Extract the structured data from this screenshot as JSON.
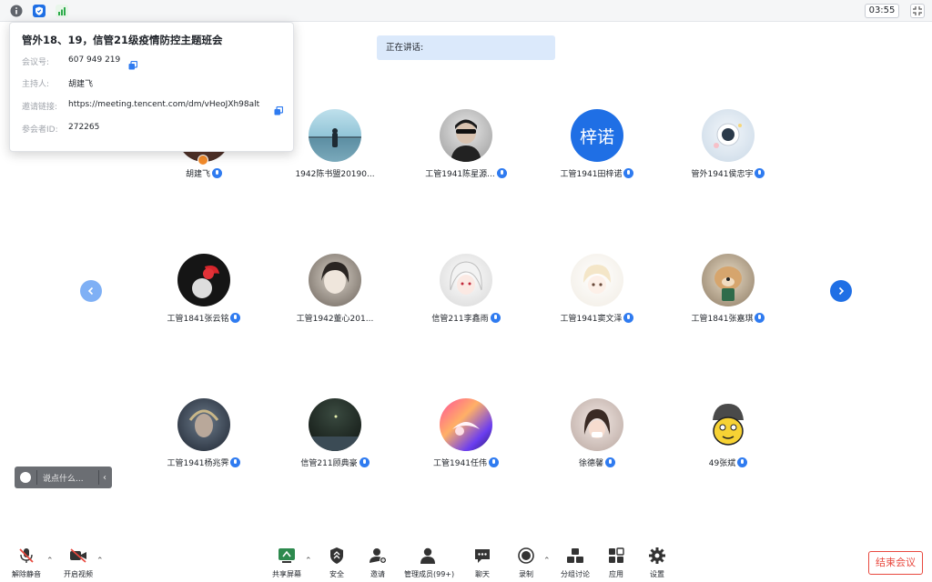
{
  "timer": "03:55",
  "meeting_info": {
    "title": "管外18、19，信管21级疫情防控主题班会",
    "rows": [
      {
        "key": "会议号:",
        "value": "607 949 219"
      },
      {
        "key": "主持人:",
        "value": "胡建飞"
      },
      {
        "key": "邀请链接:",
        "value": "https://meeting.tencent.com/dm/vHeoJXh98alt"
      },
      {
        "key": "参会者ID:",
        "value": "272265"
      }
    ]
  },
  "speaking_label": "正在讲话:",
  "participants": [
    {
      "name": "胡建飞",
      "host": true
    },
    {
      "name": "1942陈书盟20190..."
    },
    {
      "name": "工管1941陈星源..."
    },
    {
      "name": "工管1941田梓诺",
      "avatar_text": "梓诺"
    },
    {
      "name": "管外1941侯忠宇"
    },
    {
      "name": "工管1841张云铭"
    },
    {
      "name": "工管1942董心201..."
    },
    {
      "name": "信管211李鑫雨"
    },
    {
      "name": "工管1941窦文泽"
    },
    {
      "name": "工管1841张嘉琪"
    },
    {
      "name": "工管1941杨兆霁"
    },
    {
      "name": "信管211顾典豪"
    },
    {
      "name": "工管1941任伟"
    },
    {
      "name": "徐德馨"
    },
    {
      "name": "49张斌"
    }
  ],
  "chat_placeholder": "说点什么...",
  "toolbar": {
    "unmute": "解除静音",
    "start_video": "开启视频",
    "share_screen": "共享屏幕",
    "security": "安全",
    "invite": "邀请",
    "manage_members": "管理成员(99+)",
    "chat": "聊天",
    "record": "录制",
    "breakout": "分组讨论",
    "apps": "应用",
    "settings": "设置",
    "end_meeting": "结束会议"
  },
  "colors": {
    "accent": "#2f7bf0",
    "danger": "#e8483e",
    "banner": "#dbe9fb"
  }
}
